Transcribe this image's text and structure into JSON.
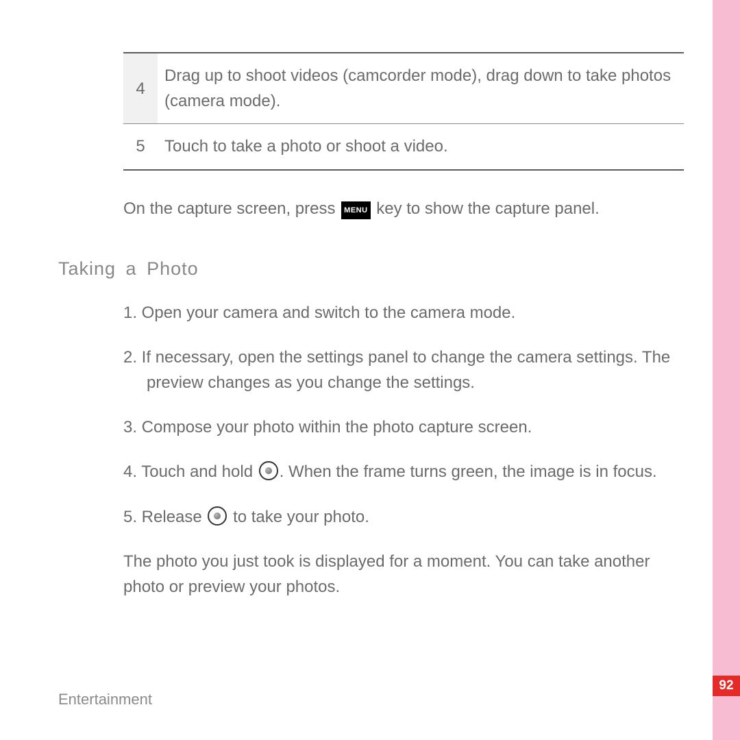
{
  "table": {
    "rows": [
      {
        "num": "4",
        "text": "Drag up to shoot videos (camcorder mode), drag down to take photos (camera mode)."
      },
      {
        "num": "5",
        "text": "Touch to take a photo or shoot a video."
      }
    ]
  },
  "capture_line": {
    "before": "On the capture screen, press",
    "menu_label": "MENU",
    "after": "key to show the capture panel."
  },
  "section_heading": "Taking  a  Photo",
  "steps": {
    "s1": "1. Open your camera and switch to the camera mode.",
    "s2": "2. If necessary, open the settings panel to change the camera settings. The preview changes as you change the settings.",
    "s3": "3. Compose your photo within the photo capture screen.",
    "s4_before": "4. Touch and hold ",
    "s4_after": ". When the frame turns green, the image is in focus.",
    "s5_before": "5. Release ",
    "s5_after": " to take your photo."
  },
  "after_note": "The photo you just took is displayed for a moment. You can take another photo or preview your photos.",
  "footer": "Entertainment",
  "page_number": "92"
}
